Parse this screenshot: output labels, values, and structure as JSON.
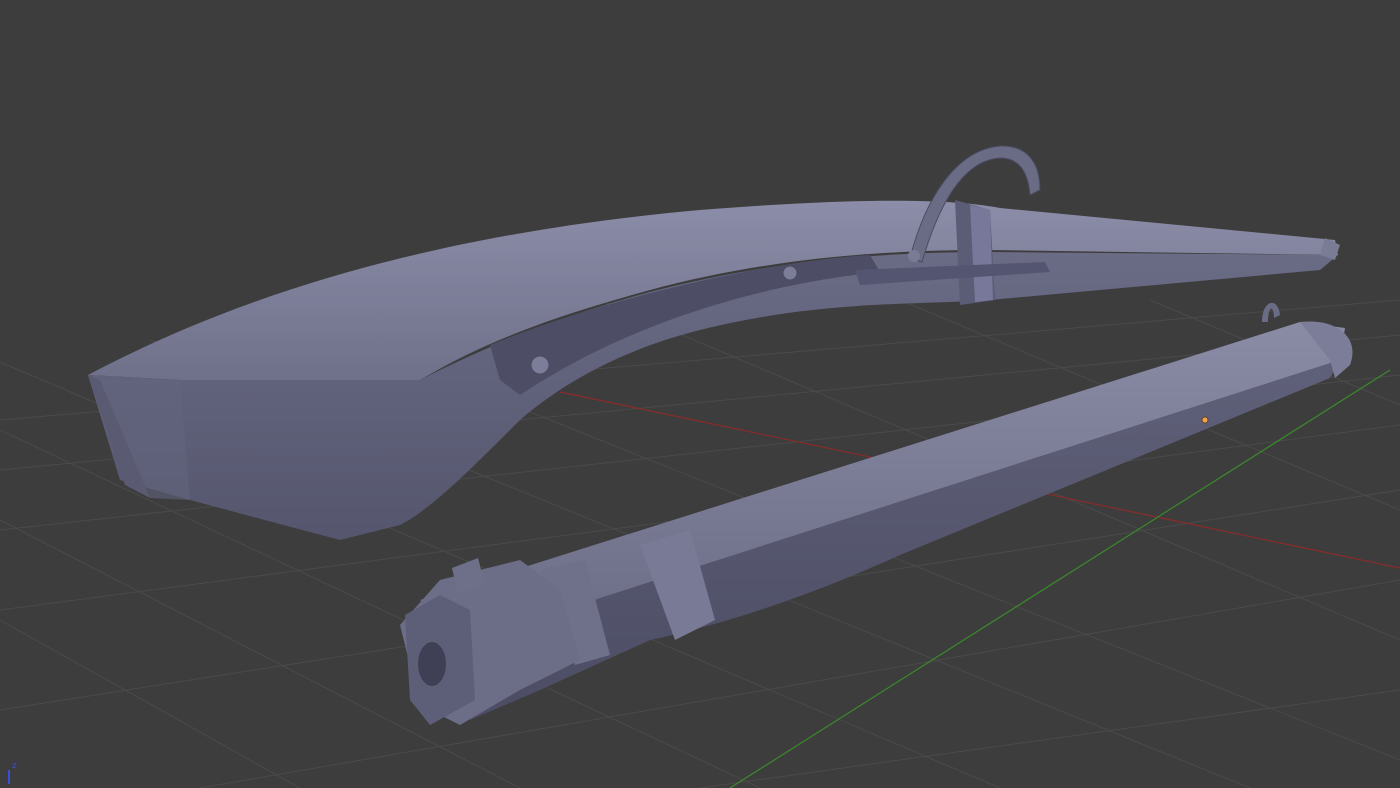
{
  "viewport": {
    "background": "#3d3d3d",
    "grid_color": "#4a4a4a",
    "x_axis_color": "#8a2b2b",
    "y_axis_color": "#3a8a2a",
    "mesh_color": "#6b6c86",
    "mesh_dark": "#474860",
    "mesh_light": "#8a8ba6",
    "origin_marker_color": "#f0a050"
  },
  "axis_gizmo": {
    "z_label": "z",
    "z_color": "#3b4fd6"
  }
}
